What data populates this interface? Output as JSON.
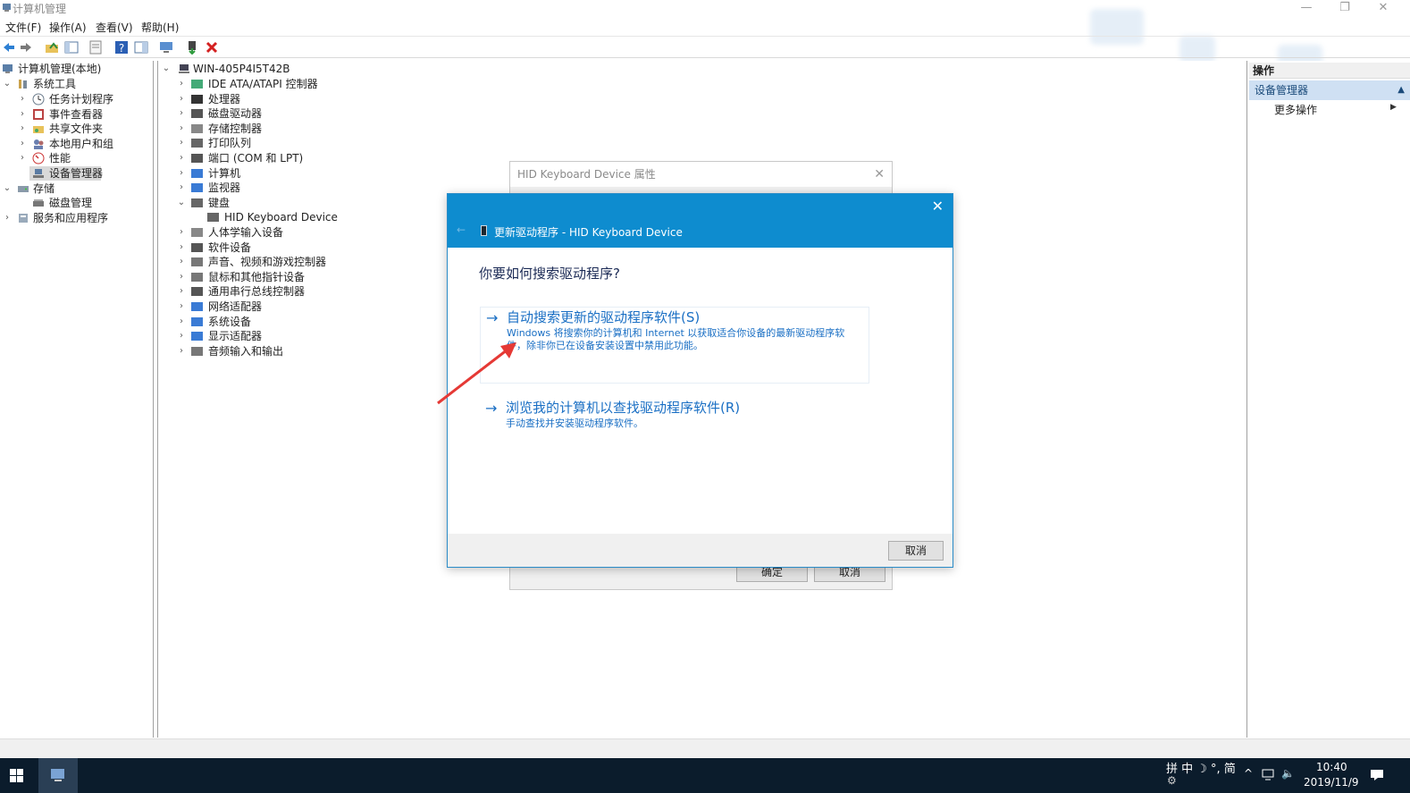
{
  "window": {
    "title": "计算机管理",
    "minimize": "—",
    "restore": "❐",
    "close": "✕"
  },
  "menu": [
    "文件(F)",
    "操作(A)",
    "查看(V)",
    "帮助(H)"
  ],
  "left_tree": {
    "root": "计算机管理(本地)",
    "system_tools": "系统工具",
    "task_scheduler": "任务计划程序",
    "event_viewer": "事件查看器",
    "shared_folders": "共享文件夹",
    "local_users": "本地用户和组",
    "performance": "性能",
    "device_manager": "设备管理器",
    "storage": "存储",
    "disk_management": "磁盘管理",
    "services_apps": "服务和应用程序"
  },
  "device_tree": {
    "computer_name": "WIN-405P4I5T42B",
    "categories": [
      "IDE ATA/ATAPI 控制器",
      "处理器",
      "磁盘驱动器",
      "存储控制器",
      "打印队列",
      "端口 (COM 和 LPT)",
      "计算机",
      "监视器",
      "键盘",
      "HID Keyboard Device",
      "人体学输入设备",
      "软件设备",
      "声音、视频和游戏控制器",
      "鼠标和其他指针设备",
      "通用串行总线控制器",
      "网络适配器",
      "系统设备",
      "显示适配器",
      "音频输入和输出"
    ]
  },
  "actions": {
    "header": "操作",
    "section": "设备管理器",
    "more": "更多操作"
  },
  "properties_dialog": {
    "title": "HID Keyboard Device 属性",
    "ok": "确定",
    "cancel": "取消"
  },
  "wizard": {
    "header_title": "更新驱动程序 - HID Keyboard Device",
    "question": "你要如何搜索驱动程序?",
    "option1_title": "自动搜索更新的驱动程序软件(S)",
    "option1_desc": "Windows 将搜索你的计算机和 Internet 以获取适合你设备的最新驱动程序软件，除非你已在设备安装设置中禁用此功能。",
    "option2_title": "浏览我的计算机以查找驱动程序软件(R)",
    "option2_desc": "手动查找并安装驱动程序软件。",
    "cancel": "取消"
  },
  "taskbar": {
    "ime": "拼 中 ☽ °, 简",
    "time": "10:40",
    "date": "2019/11/9"
  }
}
